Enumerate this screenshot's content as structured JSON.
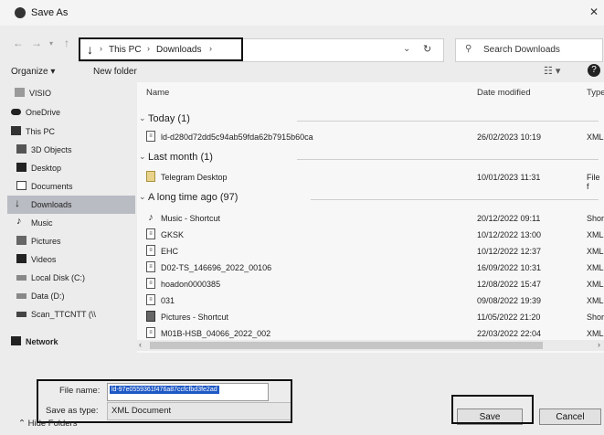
{
  "window": {
    "title": "Save As"
  },
  "address": {
    "crumbs": [
      "This PC",
      "Downloads"
    ],
    "search_placeholder": "Search Downloads"
  },
  "toolbar": {
    "organize": "Organize ▾",
    "new_folder": "New folder"
  },
  "sidebar": {
    "items": [
      {
        "label": "VISIO",
        "icon": "folder-icon"
      },
      {
        "label": "OneDrive",
        "icon": "cloud-icon"
      },
      {
        "label": "This PC",
        "icon": "pc-icon"
      },
      {
        "label": "3D Objects",
        "icon": "cube-icon"
      },
      {
        "label": "Desktop",
        "icon": "desktop-icon"
      },
      {
        "label": "Documents",
        "icon": "documents-icon"
      },
      {
        "label": "Downloads",
        "icon": "download-icon",
        "selected": true
      },
      {
        "label": "Music",
        "icon": "music-icon"
      },
      {
        "label": "Pictures",
        "icon": "pictures-icon"
      },
      {
        "label": "Videos",
        "icon": "videos-icon"
      },
      {
        "label": "Local Disk (C:)",
        "icon": "disk-icon"
      },
      {
        "label": "Data (D:)",
        "icon": "disk-icon"
      },
      {
        "label": "Scan_TTCNTT (\\\\",
        "icon": "network-drive-icon"
      },
      {
        "label": "Network",
        "icon": "network-icon"
      }
    ]
  },
  "columns": {
    "name": "Name",
    "date": "Date modified",
    "type": "Type"
  },
  "groups": [
    {
      "label": "Today (1)",
      "rows": [
        {
          "name": "ld-d280d72dd5c94ab59fda62b7915b60ca",
          "date": "26/02/2023 10:19",
          "type": "XML"
        }
      ]
    },
    {
      "label": "Last month (1)",
      "rows": [
        {
          "name": "Telegram Desktop",
          "date": "10/01/2023 11:31",
          "type": "File f"
        }
      ]
    },
    {
      "label": "A long time ago (97)",
      "rows": [
        {
          "name": "Music - Shortcut",
          "date": "20/12/2022 09:11",
          "type": "Shor"
        },
        {
          "name": "GKSK",
          "date": "10/12/2022 13:00",
          "type": "XML"
        },
        {
          "name": "EHC",
          "date": "10/12/2022 12:37",
          "type": "XML"
        },
        {
          "name": "D02-TS_146696_2022_00106",
          "date": "16/09/2022 10:31",
          "type": "XML"
        },
        {
          "name": "hoadon0000385",
          "date": "12/08/2022 15:47",
          "type": "XML"
        },
        {
          "name": "031",
          "date": "09/08/2022 19:39",
          "type": "XML"
        },
        {
          "name": "Pictures - Shortcut",
          "date": "11/05/2022 21:20",
          "type": "Shor"
        },
        {
          "name": "M01B-HSB_04066_2022_002",
          "date": "22/03/2022 22:04",
          "type": "XML"
        }
      ]
    }
  ],
  "save": {
    "filename_label": "File name:",
    "filename_value": "ld-97e0559361f476a87ccfcfbd3fe2ad",
    "type_label": "Save as type:",
    "type_value": "XML Document",
    "hide_folders": "Hide Folders",
    "save_button": "Save",
    "cancel_button": "Cancel"
  }
}
